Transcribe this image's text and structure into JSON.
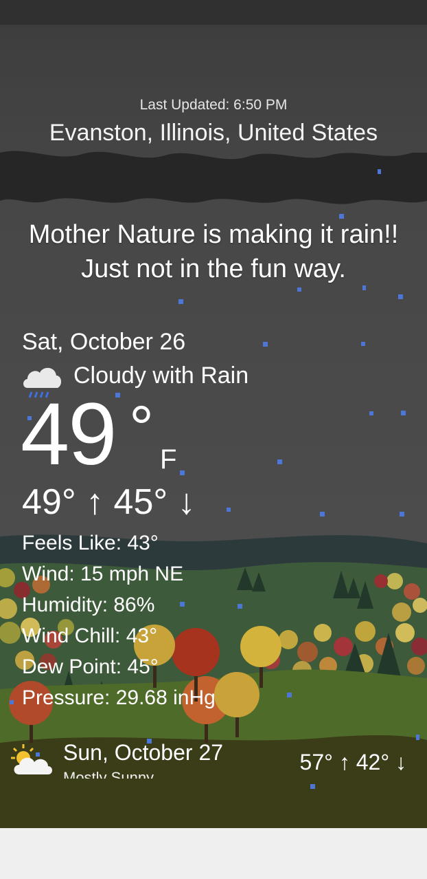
{
  "header": {
    "last_updated": "Last Updated: 6:50 PM",
    "location": "Evanston, Illinois, United States"
  },
  "headline": "Mother Nature is making it rain!! Just not in the fun way.",
  "today": {
    "date": "Sat, October 26",
    "condition": "Cloudy with Rain",
    "condition_icon": "cloud-rain-icon",
    "temperature": "49",
    "degree": "°",
    "unit": "F",
    "high_low": "49° ↑ 45° ↓",
    "details": {
      "feels_like": "Feels Like: 43°",
      "wind": "Wind: 15 mph NE",
      "humidity": "Humidity: 86%",
      "wind_chill": "Wind Chill: 43°",
      "dew_point": "Dew Point: 45°",
      "pressure": "Pressure: 29.68 inHg"
    }
  },
  "forecast": [
    {
      "date": "Sun, October 27",
      "condition": "Mostly Sunny",
      "icon": "sun-cloud-icon",
      "high_low": "57° ↑  42° ↓"
    }
  ],
  "colors": {
    "sky": "#474747",
    "storm_cloud": "#262626",
    "rain_drop": "#4d77d6",
    "hill_near": "#4f6b2a",
    "ground": "#3b3c18"
  }
}
